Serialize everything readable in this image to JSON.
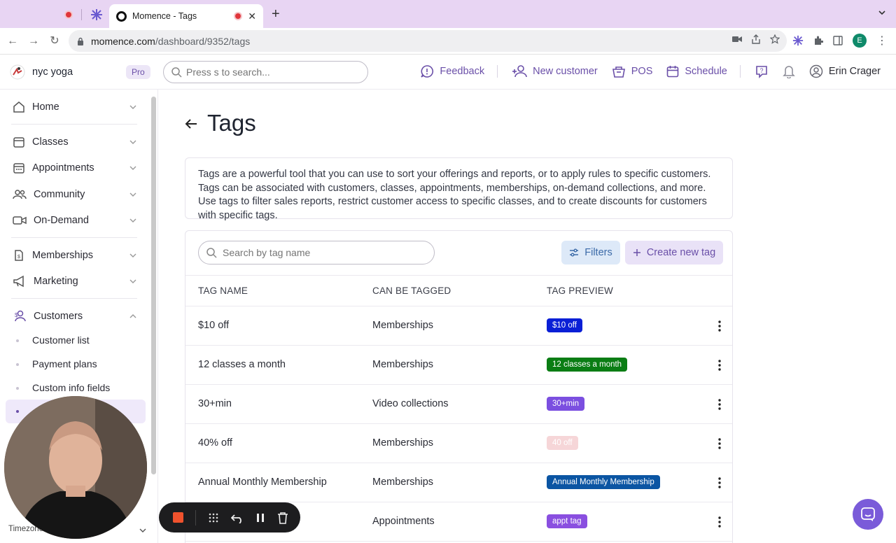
{
  "browser": {
    "tab_title": "Momence - Tags",
    "url_host": "momence.com",
    "url_path": "/dashboard/9352/tags",
    "profile_initial": "E"
  },
  "header": {
    "studio_name": "nyc yoga",
    "plan_badge": "Pro",
    "search_placeholder": "Press s to search...",
    "feedback": "Feedback",
    "new_customer": "New customer",
    "pos": "POS",
    "schedule": "Schedule",
    "user_name": "Erin Crager"
  },
  "sidebar": {
    "items": [
      {
        "label": "Home",
        "icon": "home-icon"
      },
      {
        "label": "Classes",
        "icon": "calendar-icon"
      },
      {
        "label": "Appointments",
        "icon": "calendar-grid-icon"
      },
      {
        "label": "Community",
        "icon": "users-icon"
      },
      {
        "label": "On-Demand",
        "icon": "video-icon"
      },
      {
        "label": "Memberships",
        "icon": "membership-icon"
      },
      {
        "label": "Marketing",
        "icon": "megaphone-icon"
      },
      {
        "label": "Customers",
        "icon": "customers-icon"
      }
    ],
    "sub_items": [
      "Customer list",
      "Payment plans",
      "Custom info fields"
    ],
    "timezone": "Timezone: (America)"
  },
  "page": {
    "title": "Tags",
    "description": "Tags are a powerful tool that you can use to sort your offerings and reports, or to apply rules to specific customers. Tags can be associated with customers, classes, appointments, memberships, on-demand collections, and more. Use tags to filter sales reports, restrict customer access to specific classes, and to create discounts for customers with specific tags.",
    "tag_search_placeholder": "Search by tag name",
    "filters_label": "Filters",
    "create_label": "Create new tag"
  },
  "table": {
    "columns": [
      "TAG NAME",
      "CAN BE TAGGED",
      "TAG PREVIEW"
    ],
    "rows": [
      {
        "name": "$10 off",
        "taggable": "Memberships",
        "preview": "$10 off",
        "color": "#0a1fd6",
        "text_color": "#ffffff"
      },
      {
        "name": "12 classes a month",
        "taggable": "Memberships",
        "preview": "12 classes a month",
        "color": "#0a7d14",
        "text_color": "#ffffff"
      },
      {
        "name": "30+min",
        "taggable": "Video collections",
        "preview": "30+min",
        "color": "#7b4fe0",
        "text_color": "#ffffff"
      },
      {
        "name": "40% off",
        "taggable": "Memberships",
        "preview": "40 off",
        "color": "#f6d6d8",
        "text_color": "#ffffff"
      },
      {
        "name": "Annual Monthly Membership",
        "taggable": "Memberships",
        "preview": "Annual Monthly Membership",
        "color": "#0b55a3",
        "text_color": "#ffffff"
      },
      {
        "name": "",
        "taggable": "Appointments",
        "preview": "appt tag",
        "color": "#8a4fe0",
        "text_color": "#ffffff"
      }
    ]
  },
  "colors": {
    "accent": "#6a4fa8",
    "tabbar": "#e8d5f3"
  }
}
